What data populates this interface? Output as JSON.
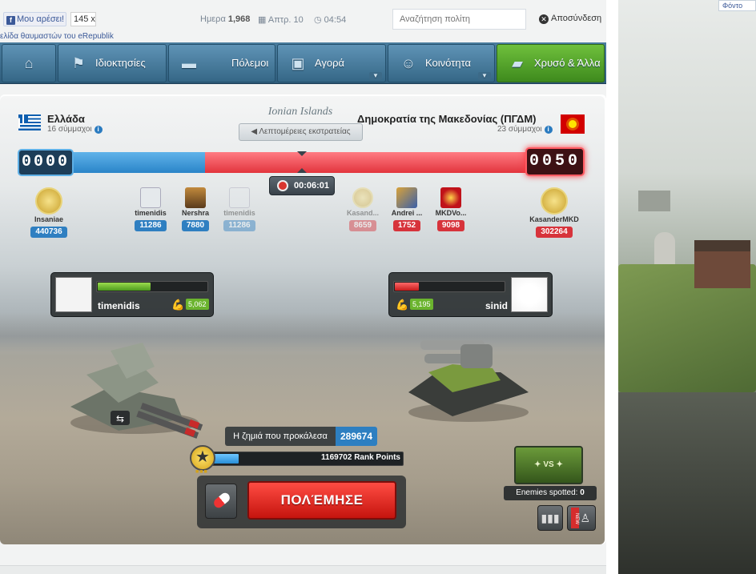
{
  "social": {
    "like_label": "Μου αρέσει!",
    "like_count": "145",
    "close": "x",
    "fan_text": "ελίδα θαυμαστών του eRepublik"
  },
  "topbar": {
    "day_label": "Ημερα",
    "day_value": "1,968",
    "cal_label": "Απτρ. 10",
    "time": "04:54",
    "search_placeholder": "Αναζήτηση πολίτη",
    "logout": "Αποσύνδεση"
  },
  "rightbg": {
    "font_link": "Φόντο"
  },
  "menu": {
    "items": [
      {
        "label": "",
        "icon": "home-icon"
      },
      {
        "label": "Ιδιοκτησίες",
        "icon": "flag-icon"
      },
      {
        "label": "Πόλεμοι",
        "icon": "tank-icon"
      },
      {
        "label": "Αγορά",
        "icon": "bag-icon"
      },
      {
        "label": "Κοινότητα",
        "icon": "people-icon"
      },
      {
        "label": "Χρυσό & Άλλα",
        "icon": "gold-icon"
      }
    ]
  },
  "battle": {
    "region": "Ionian Islands",
    "details_label": "Λεπτομέρειες εκστρατείας",
    "left": {
      "country": "Ελλάδα",
      "allies": "16 σύμμαχοι",
      "score": "0000",
      "color": "#2f7fc1"
    },
    "right": {
      "country": "Δημοκρατία της Μακεδονίας (ΠΓΔΜ)",
      "allies": "23 σύμμαχοι",
      "score": "0050",
      "color": "#d7333b"
    },
    "wall_left_percent": 33,
    "timer": "00:06:01",
    "left_fighters": [
      {
        "name": "Insaniae",
        "points": "440736"
      },
      {
        "name": "timenidis",
        "points": "11286"
      },
      {
        "name": "Nershra",
        "points": "7880"
      },
      {
        "name": "timenidis",
        "points": "11286"
      }
    ],
    "right_fighters": [
      {
        "name": "Kasand...",
        "points": "8659"
      },
      {
        "name": "Andrei ...",
        "points": "1752"
      },
      {
        "name": "MKDVo...",
        "points": "9098"
      },
      {
        "name": "KasanderMKD",
        "points": "302264"
      }
    ],
    "player_left": {
      "name": "timenidis",
      "strength": "5,062",
      "health_percent": 48
    },
    "player_right": {
      "name": "sinid",
      "strength": "5,195",
      "health_percent": 22
    },
    "damage_label": "Η ζημιά που προκάλεσα",
    "damage_value": "289674",
    "rank_points": "1169702 Rank Points",
    "rank_progress_percent": 14,
    "fight_label": "ΠΟΛΈΜΗΣΕ",
    "vs_label": "VS",
    "enemies_label": "Enemies spotted:",
    "enemies_count": "0",
    "new_label": "NEW"
  }
}
